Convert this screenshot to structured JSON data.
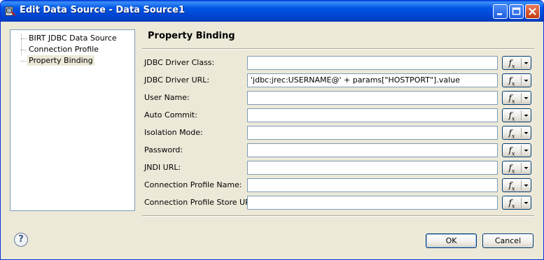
{
  "window": {
    "title": "Edit Data Source - Data Source1"
  },
  "tree": {
    "items": [
      "BIRT JDBC Data Source",
      "Connection Profile",
      "Property Binding"
    ],
    "selected": 2
  },
  "page": {
    "title": "Property Binding"
  },
  "fields": [
    {
      "label": "JDBC Driver Class:",
      "value": ""
    },
    {
      "label": "JDBC Driver URL:",
      "value": "'jdbc:jrec:USERNAME@' + params[\"HOSTPORT\"].value"
    },
    {
      "label": "User Name:",
      "value": ""
    },
    {
      "label": "Auto Commit:",
      "value": ""
    },
    {
      "label": "Isolation Mode:",
      "value": ""
    },
    {
      "label": "Password:",
      "value": ""
    },
    {
      "label": "JNDI URL:",
      "value": ""
    },
    {
      "label": "Connection Profile Name:",
      "value": ""
    },
    {
      "label": "Connection Profile Store URL:",
      "value": ""
    }
  ],
  "fx": {
    "glyph": "f",
    "sub": "x"
  },
  "buttons": {
    "ok": "OK",
    "cancel": "Cancel"
  },
  "help": {
    "glyph": "?"
  }
}
